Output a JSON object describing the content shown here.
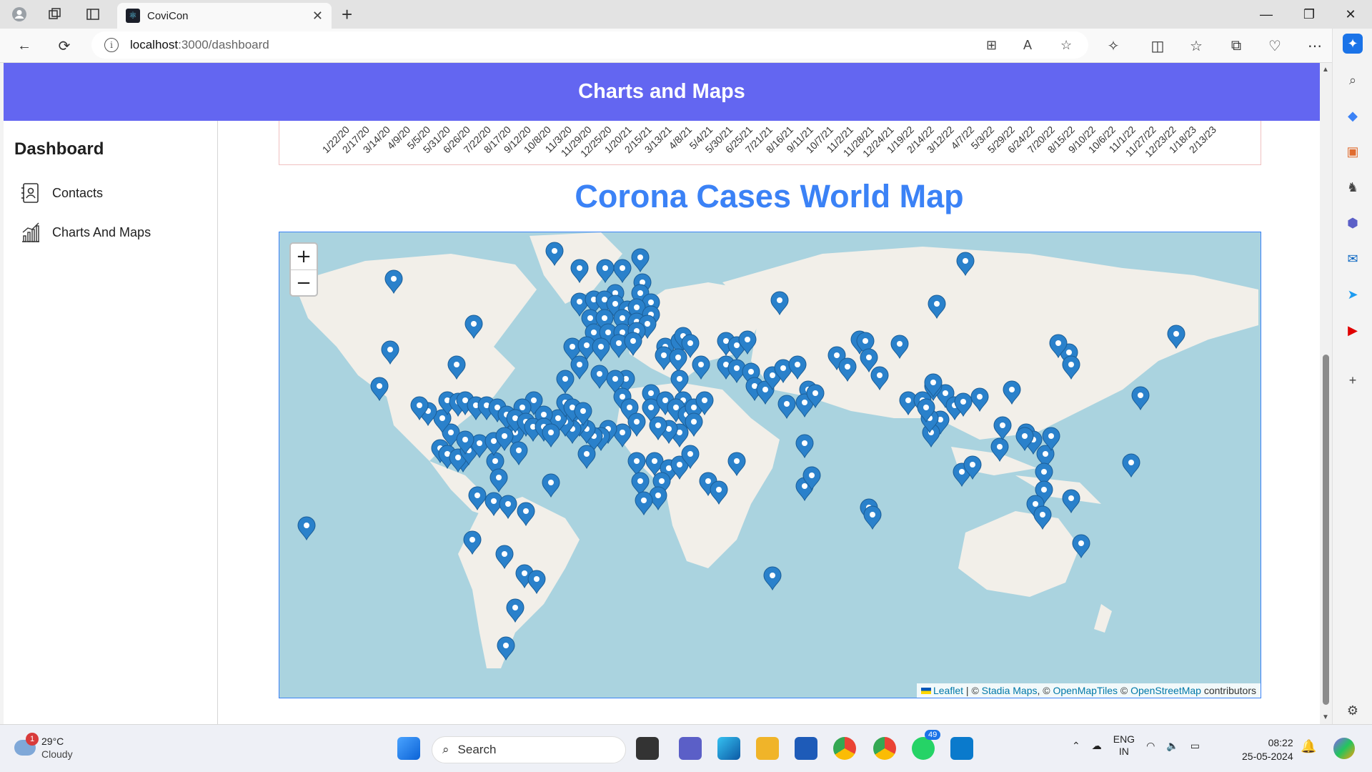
{
  "browser": {
    "tab_title": "CoviCon",
    "url_host": "localhost",
    "url_path": ":3000/dashboard",
    "window_controls": [
      "minimize-icon",
      "restore-icon",
      "close-icon"
    ]
  },
  "app": {
    "header_title": "Charts and Maps",
    "sidebar_title": "Dashboard",
    "nav_items": [
      {
        "label": "Contacts",
        "icon": "contacts-icon"
      },
      {
        "label": "Charts And Maps",
        "icon": "chart-icon"
      }
    ],
    "chart_dates": [
      "1/22/20",
      "2/17/20",
      "3/14/20",
      "4/9/20",
      "5/5/20",
      "5/31/20",
      "6/26/20",
      "7/22/20",
      "8/17/20",
      "9/12/20",
      "10/8/20",
      "11/3/20",
      "11/29/20",
      "12/25/20",
      "1/20/21",
      "2/15/21",
      "3/13/21",
      "4/8/21",
      "5/4/21",
      "5/30/21",
      "6/25/21",
      "7/21/21",
      "8/16/21",
      "9/11/21",
      "10/7/21",
      "11/2/21",
      "11/28/21",
      "12/24/21",
      "1/19/22",
      "2/14/22",
      "3/12/22",
      "4/7/22",
      "5/3/22",
      "5/29/22",
      "6/24/22",
      "7/20/22",
      "8/15/22",
      "9/10/22",
      "10/6/22",
      "11/1/22",
      "11/27/22",
      "12/23/22",
      "1/18/23",
      "2/13/23"
    ],
    "map_title": "Corona Cases World Map",
    "zoom_in": "+",
    "zoom_out": "−",
    "attribution": {
      "leaflet": "Leaflet",
      "sep1": " | © ",
      "stadia": "Stadia Maps",
      "sep2": ", © ",
      "omt": "OpenMapTiles",
      "sep3": " © ",
      "osm": "OpenStreetMap",
      "suffix": " contributors"
    },
    "map_colors": {
      "water": "#aad3df",
      "land": "#f2efe9",
      "marker": "#2a81cb"
    }
  },
  "taskbar": {
    "weather_temp": "29°C",
    "weather_desc": "Cloudy",
    "weather_badge": "1",
    "search_placeholder": "Search",
    "whatsapp_badge": "49",
    "lang_top": "ENG",
    "lang_bottom": "IN",
    "time": "08:22",
    "date": "25-05-2024"
  }
}
